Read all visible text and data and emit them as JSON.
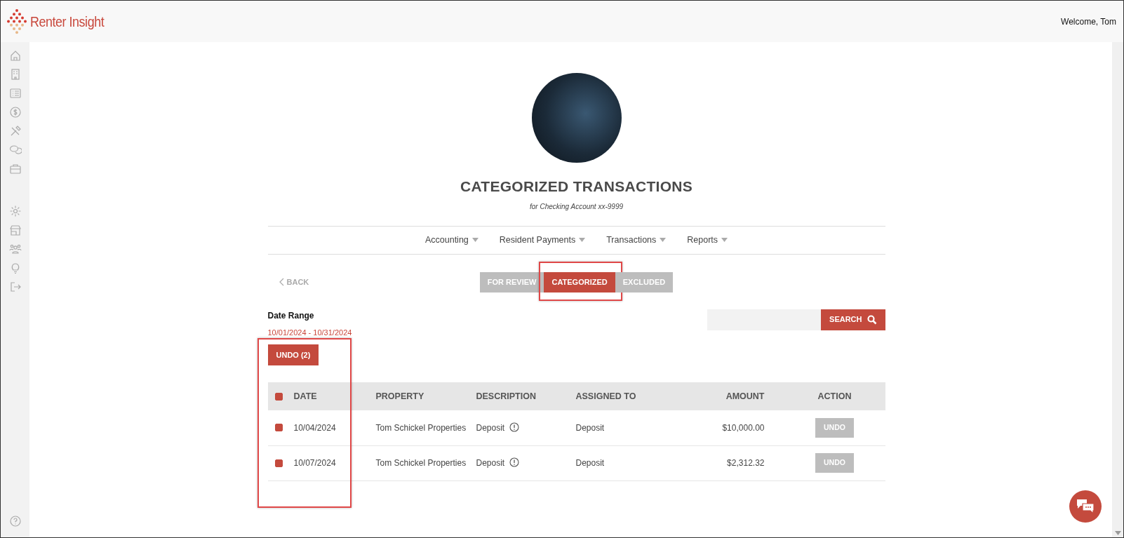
{
  "app": {
    "logo_text": "Renter Insight",
    "welcome": "Welcome, Tom"
  },
  "page": {
    "title": "CATEGORIZED TRANSACTIONS",
    "subtitle": "for Checking Account xx-9999"
  },
  "menu": [
    {
      "label": "Accounting"
    },
    {
      "label": "Resident Payments"
    },
    {
      "label": "Transactions"
    },
    {
      "label": "Reports"
    }
  ],
  "back": "BACK",
  "tabs": [
    {
      "label": "FOR REVIEW",
      "selected": false,
      "highlighted": false
    },
    {
      "label": "CATEGORIZED",
      "selected": true,
      "highlighted": true
    },
    {
      "label": "EXCLUDED",
      "selected": false,
      "highlighted": false
    }
  ],
  "date_range": {
    "label": "Date Range",
    "value": "10/01/2024 - 10/31/2024"
  },
  "search": {
    "button": "SEARCH"
  },
  "undo_button": "UNDO (2)",
  "selection_highlighted": true,
  "table": {
    "header_checked": true,
    "columns": [
      "DATE",
      "PROPERTY",
      "DESCRIPTION",
      "ASSIGNED TO",
      "AMOUNT",
      "ACTION"
    ],
    "rows": [
      {
        "checked": true,
        "date": "10/04/2024",
        "property": "Tom Schickel Properties",
        "description": "Deposit",
        "assigned_to": "Deposit",
        "amount": "$10,000.00",
        "action": "UNDO"
      },
      {
        "checked": true,
        "date": "10/07/2024",
        "property": "Tom Schickel Properties",
        "description": "Deposit",
        "assigned_to": "Deposit",
        "amount": "$2,312.32",
        "action": "UNDO"
      }
    ]
  }
}
